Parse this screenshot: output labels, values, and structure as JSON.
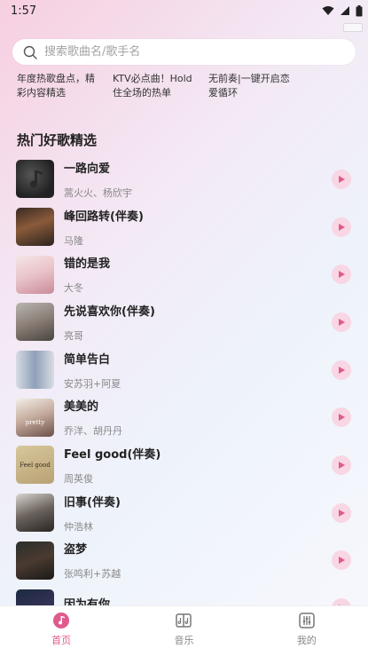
{
  "status": {
    "time": "1:57"
  },
  "search": {
    "placeholder": "搜索歌曲名/歌手名"
  },
  "topics": [
    {
      "text": "年度热歌盘点，精彩内容精选"
    },
    {
      "text": "KTV必点曲！Hold住全场的热单"
    },
    {
      "text": "无前奏|一键开启恋爱循环"
    }
  ],
  "section": {
    "title": "热门好歌精选"
  },
  "songs": [
    {
      "title": "一路向爱",
      "artist": "蒿火火、杨欣宇"
    },
    {
      "title": "峰回路转(伴奏)",
      "artist": "马隆"
    },
    {
      "title": "错的是我",
      "artist": "大冬"
    },
    {
      "title": "先说喜欢你(伴奏)",
      "artist": "亮哥"
    },
    {
      "title": "简单告白",
      "artist": "安苏羽+阿夏"
    },
    {
      "title": "美美的",
      "artist": "乔洋、胡丹丹",
      "cover_text": "pretty"
    },
    {
      "title": "Feel good(伴奏)",
      "artist": "周英俊",
      "cover_text": "Feel good"
    },
    {
      "title": "旧事(伴奏)",
      "artist": "仲浩林"
    },
    {
      "title": "盗梦",
      "artist": "张鸣利+苏越"
    },
    {
      "title": "因为有你",
      "artist": ""
    }
  ],
  "tabs": [
    {
      "label": "首页",
      "icon": "music-note-icon",
      "active": true
    },
    {
      "label": "音乐",
      "icon": "music-book-icon",
      "active": false
    },
    {
      "label": "我的",
      "icon": "equalizer-icon",
      "active": false
    }
  ],
  "colors": {
    "accent": "#e05a8d",
    "play_bg": "#f8d6e3"
  }
}
